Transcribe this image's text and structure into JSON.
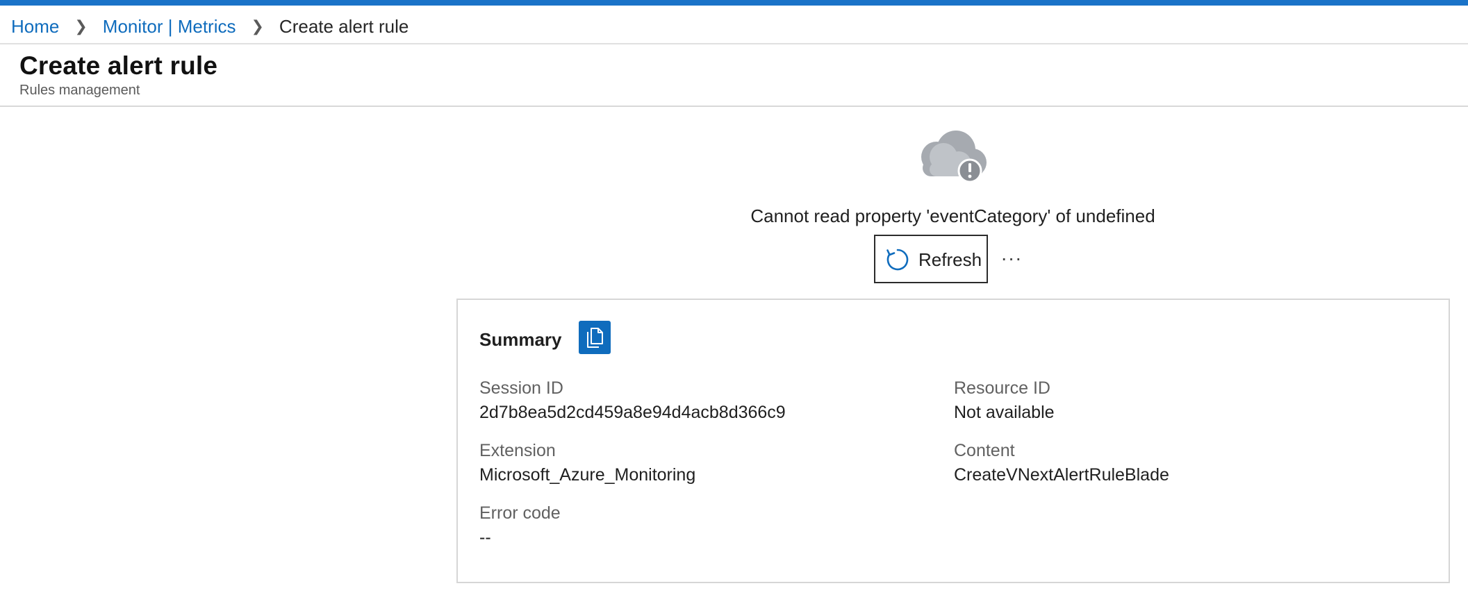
{
  "breadcrumb": {
    "items": [
      {
        "label": "Home"
      },
      {
        "label": "Monitor | Metrics"
      }
    ],
    "current": "Create alert rule"
  },
  "header": {
    "title": "Create alert rule",
    "subtitle": "Rules management"
  },
  "error": {
    "icon": "cloud-error-icon",
    "message": "Cannot read property 'eventCategory' of undefined",
    "refresh_label": "Refresh",
    "more_label": "···"
  },
  "summary": {
    "title": "Summary",
    "copy_icon": "copy-icon",
    "fields": {
      "session_id": {
        "label": "Session ID",
        "value": "2d7b8ea5d2cd459a8e94d4acb8d366c9"
      },
      "resource_id": {
        "label": "Resource ID",
        "value": "Not available"
      },
      "extension": {
        "label": "Extension",
        "value": "Microsoft_Azure_Monitoring"
      },
      "content": {
        "label": "Content",
        "value": "CreateVNextAlertRuleBlade"
      },
      "error_code": {
        "label": "Error code",
        "value": "--"
      }
    }
  },
  "colors": {
    "accent": "#1a73c8",
    "link": "#0f6cbd",
    "copy_button": "#0f6cbd",
    "cloud_back": "#a6aab0",
    "cloud_front": "#bfc3c8",
    "badge": "#8a8e94"
  }
}
